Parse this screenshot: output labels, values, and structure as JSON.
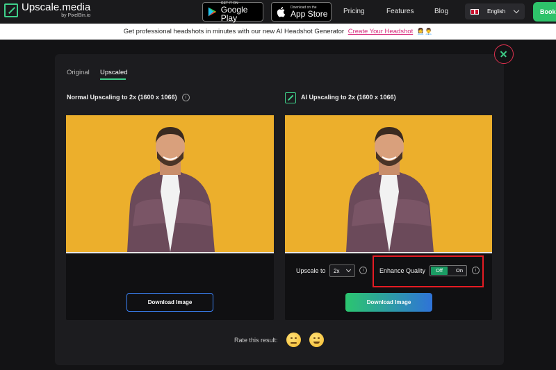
{
  "nav": {
    "logo_name": "Upscale.media",
    "logo_sub": "by PixelBin.io",
    "google_small": "GET IT ON",
    "google_big": "Google Play",
    "apple_small": "Download on the",
    "apple_big": "App Store",
    "links": [
      "Pricing",
      "Features",
      "Blog"
    ],
    "language": "English",
    "cta": "Book"
  },
  "banner": {
    "text": "Get professional headshots in minutes with our new AI Headshot Generator",
    "link": "Create Your Headshot",
    "emoji": "👩‍💼👨‍💼"
  },
  "tabs": [
    "Original",
    "Upscaled"
  ],
  "active_tab": "Upscaled",
  "left_card": {
    "title": "Normal Upscaling to 2x (1600 x 1066)",
    "download": "Download Image"
  },
  "right_card": {
    "title": "AI Upscaling to 2x (1600 x 1066)",
    "upscale_label": "Upscale to",
    "upscale_value": "2x",
    "enhance_label": "Enhance Quality",
    "toggle_off": "Off",
    "toggle_on": "On",
    "toggle_state": "Off",
    "download": "Download Image"
  },
  "rating": {
    "label": "Rate this result:"
  },
  "colors": {
    "accent_green": "#3fd08a",
    "photo_bg": "#ecaf2c",
    "highlight_red": "#e51b23",
    "banner_link": "#d6287a"
  }
}
